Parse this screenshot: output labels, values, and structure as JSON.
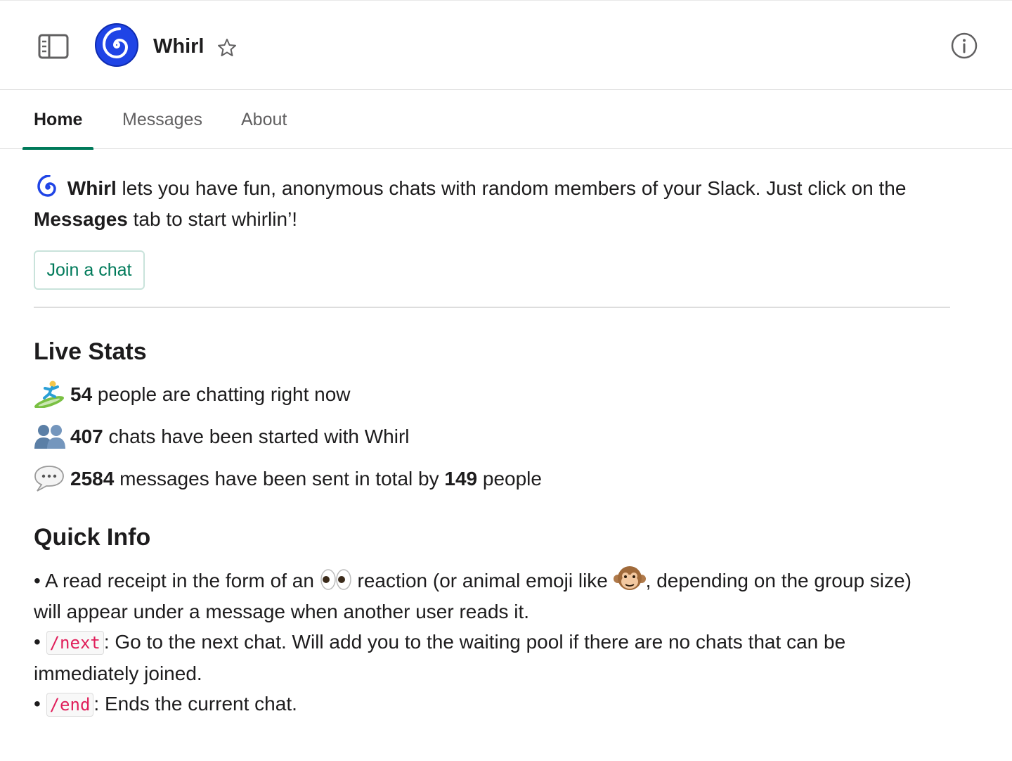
{
  "header": {
    "app_name": "Whirl",
    "icons": {
      "sidebar_toggle": "sidebar-toggle-icon",
      "logo": "whirl-cyclone-logo",
      "favorite": "star-icon",
      "details": "info-icon"
    }
  },
  "tabs": [
    {
      "label": "Home",
      "active": true
    },
    {
      "label": "Messages",
      "active": false
    },
    {
      "label": "About",
      "active": false
    }
  ],
  "intro": {
    "icon": "cyclone-emoji",
    "app_name": "Whirl",
    "text_1": " lets you have fun, anonymous chats with random members of your Slack. Just click on the ",
    "tab_name": "Messages",
    "text_2": " tab to start whirlin’!"
  },
  "join_button": {
    "label": "Join a chat"
  },
  "live_stats": {
    "title": "Live Stats",
    "items": [
      {
        "icon": "surfer-emoji",
        "value": "54",
        "text": " people are chatting right now"
      },
      {
        "icon": "busts-emoji",
        "value": "407",
        "text": " chats have been started with Whirl"
      },
      {
        "icon": "speech-balloon-emoji",
        "value": "2584",
        "text": " messages have been sent in total by ",
        "value_2": "149",
        "text_2": " people"
      }
    ]
  },
  "quick_info": {
    "title": "Quick Info",
    "bullet": "•",
    "item_1": {
      "text_1": " A read receipt in the form of an ",
      "icon_1": "eyes-emoji",
      "text_2": " reaction (or animal emoji like ",
      "icon_2": "monkey-face-emoji",
      "text_3": ", depending on the group size) will appear under a message when another user reads it."
    },
    "item_2": {
      "command": "/next",
      "text": ": Go to the next chat. Will add you to the waiting pool if there are no chats that can be immediately joined."
    },
    "item_3": {
      "command": "/end",
      "text": ": Ends the current chat."
    }
  },
  "colors": {
    "accent_green": "#007a5a",
    "code_red": "#e01e5a",
    "logo_blue": "#1a3fe0",
    "divider": "#dddddd"
  }
}
